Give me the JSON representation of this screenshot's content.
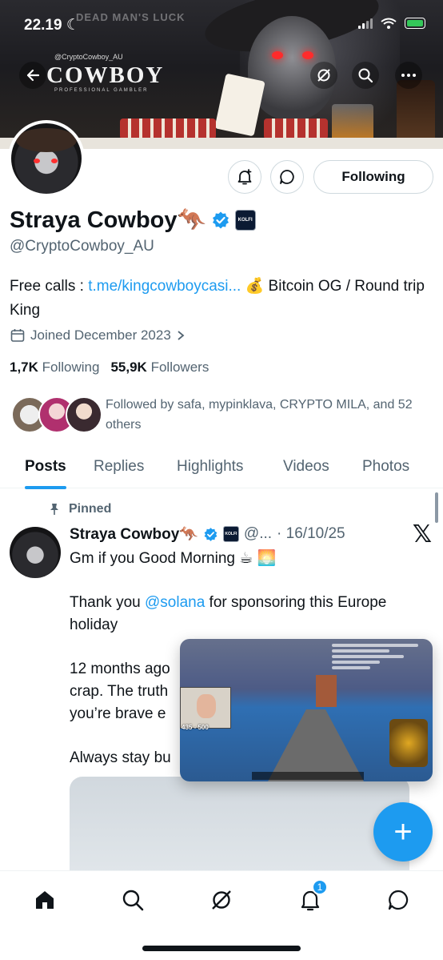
{
  "status_bar": {
    "time": "22.19"
  },
  "banner": {
    "sign_text": "DEAD MAN'S LUCK",
    "logo_handle": "@CryptoCowboy_AU",
    "logo_text": "COWBOY",
    "logo_subtitle": "PROFESSIONAL GAMBLER"
  },
  "profile": {
    "name": "Straya Cowboy🦘",
    "handle": "@CryptoCowboy_AU",
    "affiliate_badge": "KOLFI",
    "follow_button": "Following",
    "bio_prefix": "Free calls : ",
    "bio_link": "t.me/kingcowboycasi...",
    "bio_suffix": " 💰 Bitcoin OG / Round trip King",
    "joined": "Joined December 2023",
    "following_count": "1,7K",
    "following_label": "Following",
    "followers_count": "55,9K",
    "followers_label": "Followers",
    "followed_by": "Followed by safa, mypinklava, CRYPTO MILA, and 52 others"
  },
  "tabs": [
    "Posts",
    "Replies",
    "Highlights",
    "Videos",
    "Photos"
  ],
  "post": {
    "pinned_label": "Pinned",
    "author": "Straya Cowboy🦘",
    "handle_truncated": "@...",
    "date": "· 16/10/25",
    "line1": "Gm if you Good Morning ☕ 🌅",
    "line2_prefix": "Thank you ",
    "line2_mention": "@solana",
    "line2_suffix": " for sponsoring this Europe holiday",
    "line3": "12 months ago crap. The truth you’re brave e",
    "line4": "Always stay bu"
  },
  "pip": {
    "score": "435 - 500"
  },
  "fab": {
    "label": "+"
  },
  "bottom_nav": {
    "notifications_badge": "1"
  },
  "colors": {
    "accent": "#1d9bf0",
    "text": "#0f1419",
    "muted": "#536471",
    "verified": "#1d9bf0"
  }
}
